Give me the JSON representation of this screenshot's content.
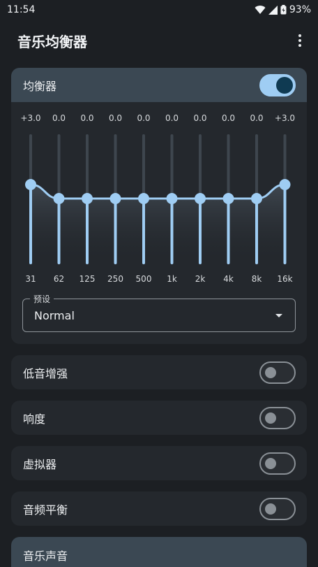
{
  "status": {
    "time": "11:54",
    "battery": "93%"
  },
  "app": {
    "title": "音乐均衡器"
  },
  "equalizer": {
    "label": "均衡器",
    "enabled": true,
    "bands": [
      {
        "gain": "+3.0",
        "freq": "31",
        "value": 3.0
      },
      {
        "gain": "0.0",
        "freq": "62",
        "value": 0.0
      },
      {
        "gain": "0.0",
        "freq": "125",
        "value": 0.0
      },
      {
        "gain": "0.0",
        "freq": "250",
        "value": 0.0
      },
      {
        "gain": "0.0",
        "freq": "500",
        "value": 0.0
      },
      {
        "gain": "0.0",
        "freq": "1k",
        "value": 0.0
      },
      {
        "gain": "0.0",
        "freq": "2k",
        "value": 0.0
      },
      {
        "gain": "0.0",
        "freq": "4k",
        "value": 0.0
      },
      {
        "gain": "0.0",
        "freq": "8k",
        "value": 0.0
      },
      {
        "gain": "+3.0",
        "freq": "16k",
        "value": 3.0
      }
    ],
    "preset_legend": "预设",
    "preset_value": "Normal"
  },
  "settings": [
    {
      "label": "低音增强",
      "enabled": false
    },
    {
      "label": "响度",
      "enabled": false
    },
    {
      "label": "虚拟器",
      "enabled": false
    },
    {
      "label": "音频平衡",
      "enabled": false
    }
  ],
  "music_sound": {
    "label": "音乐声音"
  },
  "colors": {
    "background": "#1c1f23",
    "card": "#24282d",
    "header": "#3b4853",
    "accent": "#9fcdf3",
    "knob_dark": "#0f3a52",
    "track": "#3e464e"
  }
}
